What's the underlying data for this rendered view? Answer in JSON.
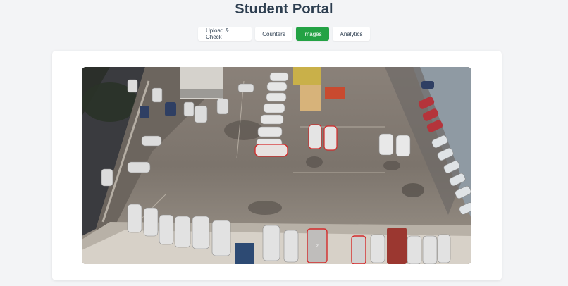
{
  "page": {
    "title": "Student Portal"
  },
  "tabs": [
    {
      "label": "Upload & Check",
      "active": false
    },
    {
      "label": "Counters",
      "active": false
    },
    {
      "label": "Images",
      "active": true
    },
    {
      "label": "Analytics",
      "active": false
    }
  ],
  "colors": {
    "active_tab": "#23a244",
    "title": "#2d3e50",
    "background": "#f3f4f6",
    "detection_box": "#d42a2a"
  },
  "image": {
    "subject": "aerial parking lot photo with detection boxes",
    "box_labels": [
      "2"
    ]
  }
}
